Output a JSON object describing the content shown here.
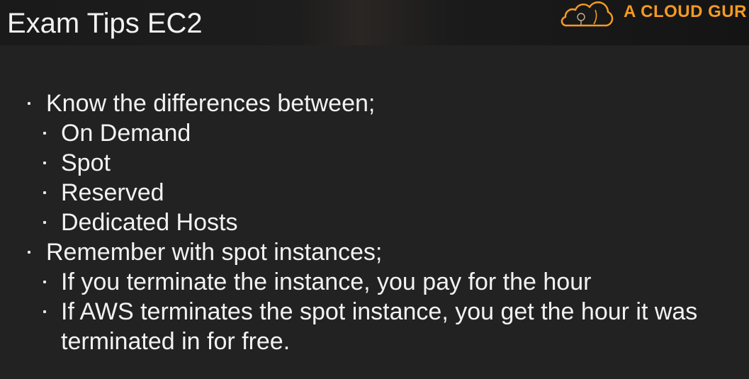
{
  "header": {
    "title": "Exam Tips EC2",
    "logo_text": "A CLOUD GUR"
  },
  "colors": {
    "background": "#222223",
    "text": "#f2f2f2",
    "brand_orange": "#f59a23"
  },
  "icons": {
    "logo": "cloud-logo-icon",
    "bullet": "bullet-icon"
  },
  "content": {
    "items": [
      {
        "text": "Know the differences between;"
      },
      {
        "text": "On Demand"
      },
      {
        "text": "Spot"
      },
      {
        "text": "Reserved"
      },
      {
        "text": "Dedicated Hosts"
      },
      {
        "text": "Remember with spot instances;"
      },
      {
        "text": "If you terminate the instance, you pay for the hour"
      },
      {
        "text": "If AWS terminates the spot instance, you get the hour it was"
      },
      {
        "text": "terminated in for free."
      }
    ]
  }
}
